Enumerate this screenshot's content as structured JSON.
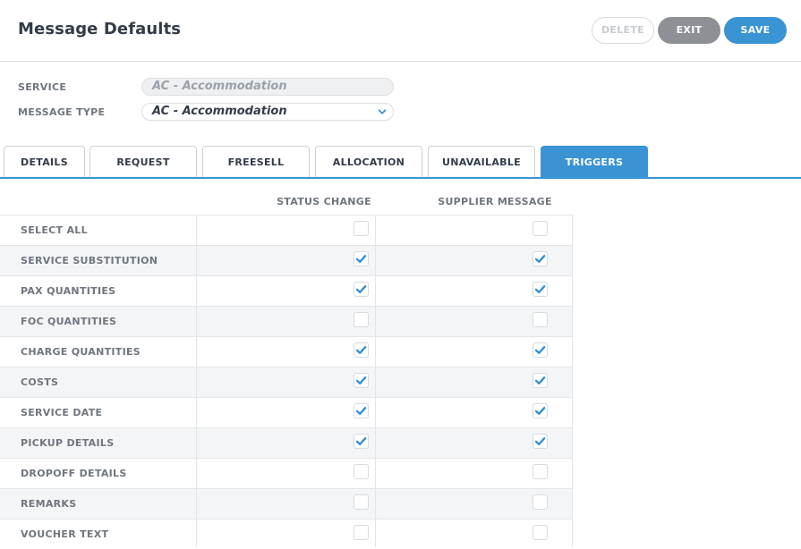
{
  "header": {
    "title": "Message Defaults",
    "delete_label": "DELETE",
    "exit_label": "EXIT",
    "save_label": "SAVE"
  },
  "form": {
    "service_label": "SERVICE",
    "service_value": "AC - Accommodation",
    "message_type_label": "MESSAGE TYPE",
    "message_type_value": "AC - Accommodation"
  },
  "tabs": [
    {
      "label": "DETAILS"
    },
    {
      "label": "REQUEST"
    },
    {
      "label": "FREESELL"
    },
    {
      "label": "ALLOCATION"
    },
    {
      "label": "UNAVAILABLE"
    },
    {
      "label": "TRIGGERS",
      "active": true
    }
  ],
  "triggers": {
    "columns": [
      "STATUS CHANGE",
      "SUPPLIER MESSAGE"
    ],
    "rows": [
      {
        "label": "SELECT ALL",
        "status_change": false,
        "supplier_message": false
      },
      {
        "label": "SERVICE SUBSTITUTION",
        "status_change": true,
        "supplier_message": true
      },
      {
        "label": "PAX QUANTITIES",
        "status_change": true,
        "supplier_message": true
      },
      {
        "label": "FOC QUANTITIES",
        "status_change": false,
        "supplier_message": false
      },
      {
        "label": "CHARGE QUANTITIES",
        "status_change": true,
        "supplier_message": true
      },
      {
        "label": "COSTS",
        "status_change": true,
        "supplier_message": true
      },
      {
        "label": "SERVICE DATE",
        "status_change": true,
        "supplier_message": true
      },
      {
        "label": "PICKUP DETAILS",
        "status_change": true,
        "supplier_message": true
      },
      {
        "label": "DROPOFF DETAILS",
        "status_change": false,
        "supplier_message": false
      },
      {
        "label": "REMARKS",
        "status_change": false,
        "supplier_message": false
      },
      {
        "label": "VOUCHER TEXT",
        "status_change": false,
        "supplier_message": false
      }
    ]
  },
  "colors": {
    "accent": "#3a93d3",
    "exit_button": "#8d9196",
    "check": "#2f8fd5"
  }
}
